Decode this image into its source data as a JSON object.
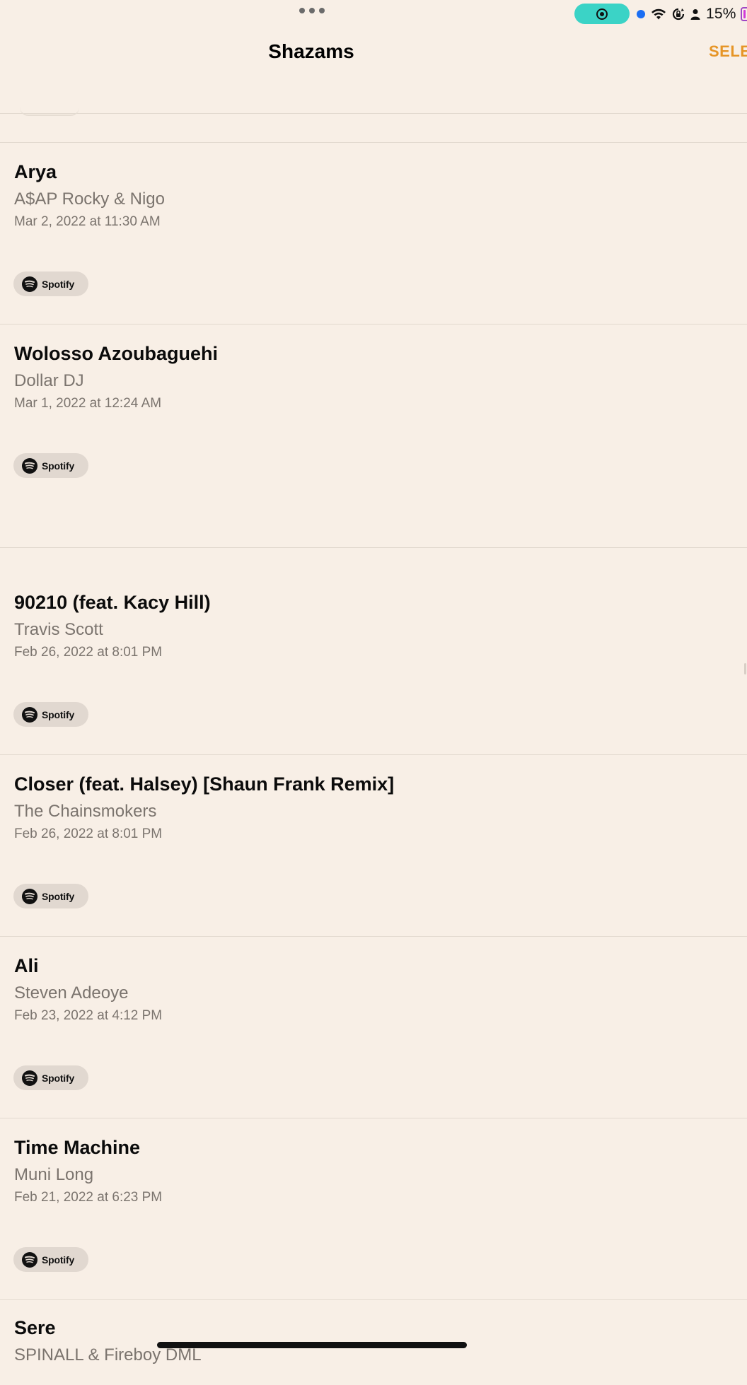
{
  "status_bar": {
    "battery_percent": "15%",
    "colors": {
      "recording": "#3bd3c6",
      "location_dot": "#1b6ef3",
      "battery": "#d23ad8"
    }
  },
  "nav": {
    "title": "Shazams",
    "select_label": "SELE"
  },
  "accent_color": "#e69527",
  "spotify_label": "Spotify",
  "songs": [
    {
      "title": "Arya",
      "artist": "A$AP Rocky & Nigo",
      "date": "Mar 2, 2022 at 11:30 AM"
    },
    {
      "title": "Wolosso Azoubaguehi",
      "artist": "Dollar DJ",
      "date": "Mar 1, 2022 at 12:24 AM"
    },
    {
      "title": "90210 (feat. Kacy Hill)",
      "artist": "Travis Scott",
      "date": "Feb 26, 2022 at 8:01 PM"
    },
    {
      "title": "Closer (feat. Halsey) [Shaun Frank Remix]",
      "artist": "The Chainsmokers",
      "date": "Feb 26, 2022 at 8:01 PM"
    },
    {
      "title": "Ali",
      "artist": "Steven Adeoye",
      "date": "Feb 23, 2022 at 4:12 PM"
    },
    {
      "title": "Time Machine",
      "artist": "Muni Long",
      "date": "Feb 21, 2022 at 6:23 PM"
    },
    {
      "title": "Sere",
      "artist": "SPINALL & Fireboy DML"
    }
  ]
}
